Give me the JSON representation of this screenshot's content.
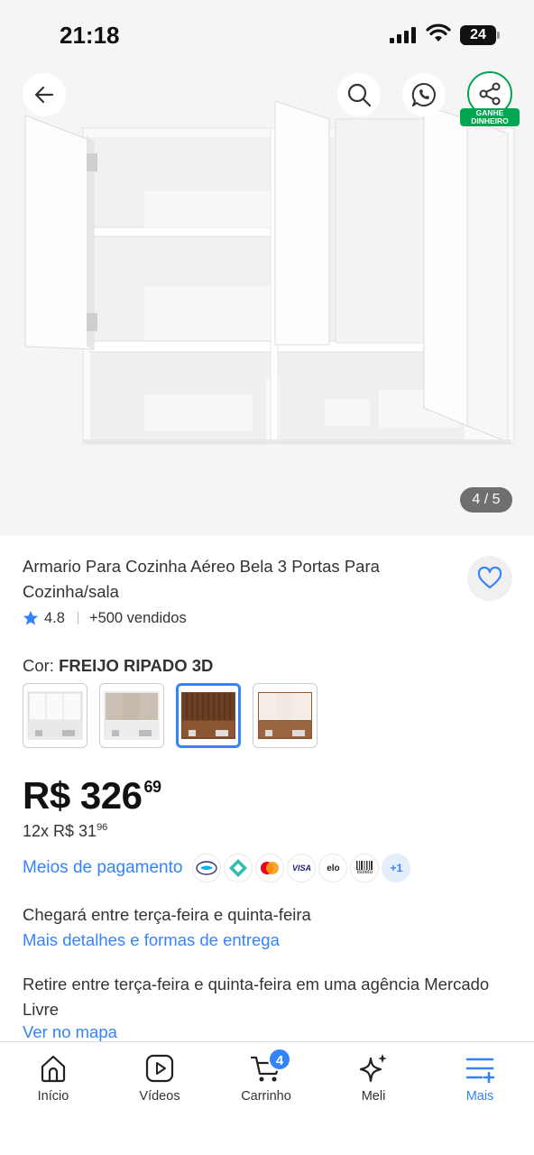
{
  "status_bar": {
    "time": "21:18",
    "battery": "24"
  },
  "gallery": {
    "counter": "4 / 5",
    "share_badge": "GANHE DINHEIRO",
    "icons": [
      "back-arrow-icon",
      "search-icon",
      "whatsapp-icon",
      "share-icon"
    ]
  },
  "product": {
    "title": "Armario Para Cozinha Aéreo Bela 3 Portas Para Cozinha/sala",
    "rating": "4.8",
    "sold": "+500 vendidos",
    "color_label": "Cor:",
    "color_value": "FREIJO RIPADO 3D",
    "swatches": [
      "white",
      "beige",
      "freijo-ripado",
      "off-white-wood"
    ],
    "selected_swatch": 2,
    "price_main": "R$ 326",
    "price_cents": "69",
    "installment_prefix": "12x R$ 31",
    "installment_cents": "96"
  },
  "payment": {
    "link": "Meios de pagamento",
    "methods": [
      "mercado-pago",
      "pix",
      "mastercard",
      "VISA",
      "elo",
      "Boleto"
    ],
    "more": "+1"
  },
  "shipping": {
    "delivery": "Chegará entre terça-feira e quinta-feira",
    "delivery_link": "Mais detalhes e formas de entrega",
    "pickup": "Retire entre terça-feira e quinta-feira em uma agência Mercado Livre",
    "pickup_link": "Ver no mapa"
  },
  "bottom_nav": {
    "items": [
      {
        "label": "Início",
        "icon": "home-icon"
      },
      {
        "label": "Vídeos",
        "icon": "video-icon"
      },
      {
        "label": "Carrinho",
        "icon": "cart-icon",
        "badge": "4"
      },
      {
        "label": "Meli",
        "icon": "sparkle-icon"
      },
      {
        "label": "Mais",
        "icon": "menu-plus-icon",
        "active": true
      }
    ]
  },
  "colors": {
    "accent": "#3483fa",
    "green": "#00a650",
    "gallery_bg": "#f5f5f5"
  }
}
